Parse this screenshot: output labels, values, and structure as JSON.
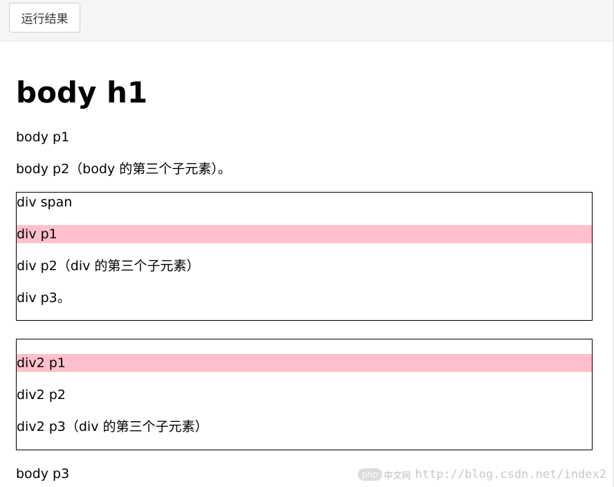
{
  "toolbar": {
    "run_label": "运行结果"
  },
  "result": {
    "h1": "body h1",
    "body_p1": "body p1",
    "body_p2": "body p2（body 的第三个子元素）。",
    "div1": {
      "span": "div span",
      "p1": "div p1",
      "p2": "div p2（div 的第三个子元素）",
      "p3": "div p3。"
    },
    "div2": {
      "p1": "div2 p1",
      "p2": "div2 p2",
      "p3": "div2 p3（div 的第三个子元素）"
    },
    "body_p3": "body p3"
  },
  "watermark": {
    "logo": "php",
    "logo_text": "中文网",
    "url": "http://blog.csdn.net/index2"
  },
  "colors": {
    "highlight": "#ffc0cb",
    "toolbar_bg": "#f5f5f5"
  }
}
